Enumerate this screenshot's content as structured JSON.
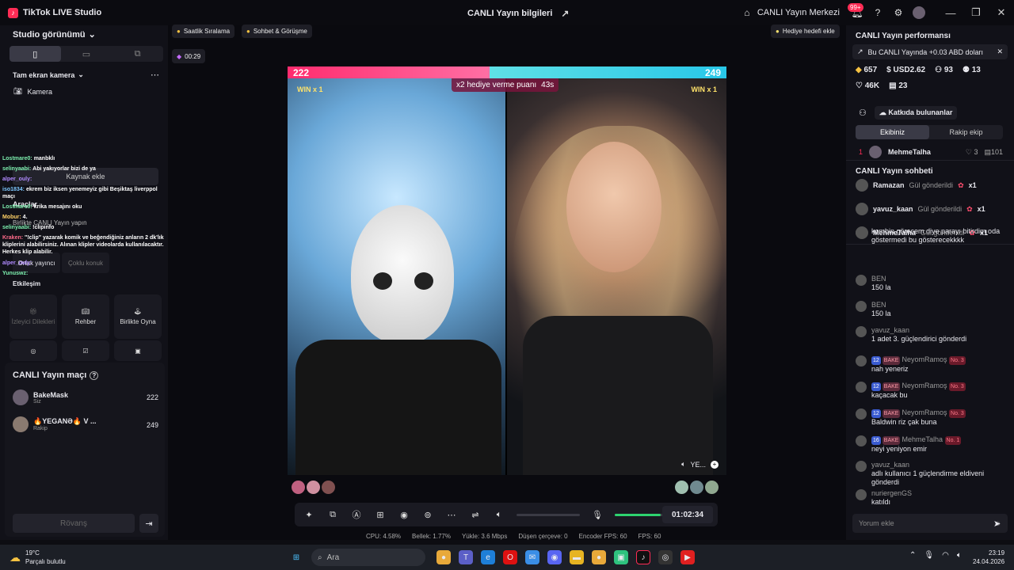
{
  "titlebar": {
    "app_name": "TikTok LIVE Studio",
    "center_title": "CANLI Yayın bilgileri",
    "center_link": "CANLI Yayın Merkezi",
    "notif_badge": "99+"
  },
  "left": {
    "studio_view": "Studio görünümü",
    "fullscreen_cam": "Tam ekran kamera",
    "camera": "Kamera",
    "add_source": "Kaynak ekle",
    "tools": "Araçlar",
    "play_together_sub": "Birlikte CANLI Yayın yapın",
    "co_host": "Ortak yayıncı",
    "multi_guest": "Çoklu konuk",
    "engagement": "Etkileşim",
    "tool_wishes": "İzleyici Dilekleri",
    "tool_guide": "Rehber",
    "tool_play": "Birlikte Oyna",
    "match_title": "CANLI Yayın maçı",
    "p1_name": "BakeMask",
    "p1_sub": "Siz",
    "p1_score": "222",
    "p2_name": "🔥YEGANƏ🔥 V ...",
    "p2_sub": "Rakip",
    "p2_score": "249",
    "rematch": "Rövanş"
  },
  "overlay_chat": [
    {
      "u": "Lostmare0:",
      "m": "manbklı"
    },
    {
      "u": "selinyaabi:",
      "m": "Abi yakıyorlar bizi de ya"
    },
    {
      "u": "alper_ouly:",
      "m": ""
    },
    {
      "u": "iso1834:",
      "m": "ekrem biz iksen yenemeyiz gibi Beşiktaş liverppol maçı"
    },
    {
      "u": "Lostmare0:",
      "m": "krika mesajını oku"
    },
    {
      "u": "Mobur:",
      "m": "4."
    },
    {
      "u": "selinyaabi:",
      "m": "!clipinfo"
    },
    {
      "u": "Kraken:",
      "m": "\"!clip\" yazarak komik ve beğendiğiniz anların 2 dk'lık kliplerini alabilirsiniz. Alınan klipler videolarda kullanılacaktır. Herkes klip alabilir."
    },
    {
      "u": "alper_ouly:",
      "m": ""
    },
    {
      "u": "Yunuswz:",
      "m": ""
    }
  ],
  "canvas": {
    "chip1": "Saatlik Sıralama",
    "chip2": "Sohbet & Görüşme",
    "gift_goal": "Hediye hedefi ekle",
    "rec_time": "00:29",
    "score_left": "222",
    "score_right": "249",
    "win_left": "WIN x 1",
    "win_right": "WIN x 1",
    "x2_text": "x2 hediye verme puanı",
    "x2_time": "43s",
    "guest_label": "YE...",
    "timer": "01:02:34"
  },
  "stats": {
    "cpu": "CPU: 4.58%",
    "mem": "Bellek: 1.77%",
    "upload": "Yükle: 3.6 Mbps",
    "drop": "Düşen çerçeve: 0",
    "enc": "Encoder FPS: 60",
    "fps": "FPS: 60"
  },
  "right": {
    "perf_title": "CANLI Yayın performansı",
    "perf_msg": "Bu CANLI Yayında +0.03 ABD doları",
    "s_coins": "657",
    "s_usd": "USD2.62",
    "s_viewers": "93",
    "s_follow": "13",
    "s_likes": "46K",
    "s_gifters": "23",
    "contributors": "Katkıda bulunanlar",
    "tab_mine": "Ekibiniz",
    "tab_rival": "Rakip ekip",
    "top_rank": "1",
    "top_name": "MehmeTalha",
    "top_a": "3",
    "top_b": "101",
    "chat_title": "CANLI Yayın sohbeti",
    "gifts": [
      {
        "u": "Ramazan",
        "m": "Gül gönderildi",
        "x": "x1"
      },
      {
        "u": "yavuz_kaan",
        "m": "Gül gönderildi",
        "x": "x1"
      },
      {
        "u": "MehmeTalha",
        "m": "Gül gönderildi",
        "x": "x1"
      }
    ],
    "msgs": [
      {
        "u": "",
        "m": "kombin görecem diye parayı bitirdim oda göstermedi bu gösterecekkkk"
      },
      {
        "u": "BEN",
        "m": "150 la"
      },
      {
        "u": "BEN",
        "m": "150 la"
      },
      {
        "u": "yavuz_kaan",
        "m": "1 adet 3. güçlendirici gönderdi"
      },
      {
        "u": "NeyomRamoş",
        "m": "nah yeneriz",
        "lvl": "12",
        "no": "No. 3"
      },
      {
        "u": "NeyomRamoş",
        "m": "kaçacak bu",
        "lvl": "12",
        "no": "No. 3"
      },
      {
        "u": "NeyomRamoş",
        "m": "Baldwin riz çak buna",
        "lvl": "12",
        "no": "No. 3"
      },
      {
        "u": "MehmeTalha",
        "m": "neyi yeniyon emir",
        "lvl": "16",
        "no": "No. 1"
      },
      {
        "u": "yavuz_kaan",
        "m": "adlı kullanıcı 1 güçlendirme eldiveni gönderdi"
      },
      {
        "u": "nuriergenGS",
        "m": "katıldı"
      }
    ],
    "bake": "BAKE",
    "comment_ph": "Yorum ekle"
  },
  "taskbar": {
    "temp": "19°C",
    "weather": "Parçalı bulutlu",
    "search": "Ara",
    "time": "23:19",
    "date": "24.04.2026"
  }
}
